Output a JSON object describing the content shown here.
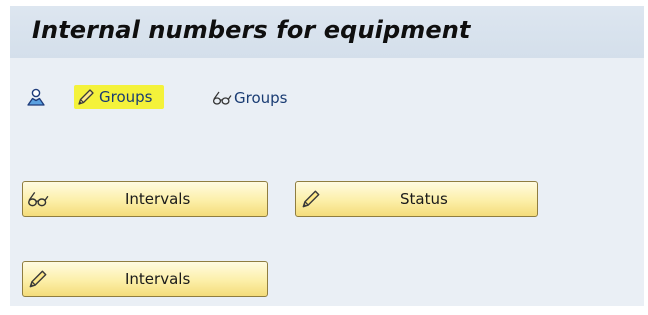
{
  "title": "Internal numbers for equipment",
  "toolbar": {
    "items": [
      {
        "icon": "user-icon",
        "label": ""
      },
      {
        "icon": "pencil-icon",
        "label": "Groups",
        "highlighted": true
      },
      {
        "icon": "glasses-icon",
        "label": "Groups"
      }
    ]
  },
  "buttons": {
    "intervals_display": {
      "icon": "glasses-icon",
      "label": "Intervals"
    },
    "status_change": {
      "icon": "pencil-icon",
      "label": "Status"
    },
    "intervals_change": {
      "icon": "pencil-icon",
      "label": "Intervals"
    }
  },
  "colors": {
    "background": "#eaeff5",
    "title_bar": "#d8e2ee",
    "button_fill": "#fcefa8",
    "button_border": "#8f7d40",
    "highlight": "#f4f23a",
    "link_text": "#1a3c73"
  }
}
